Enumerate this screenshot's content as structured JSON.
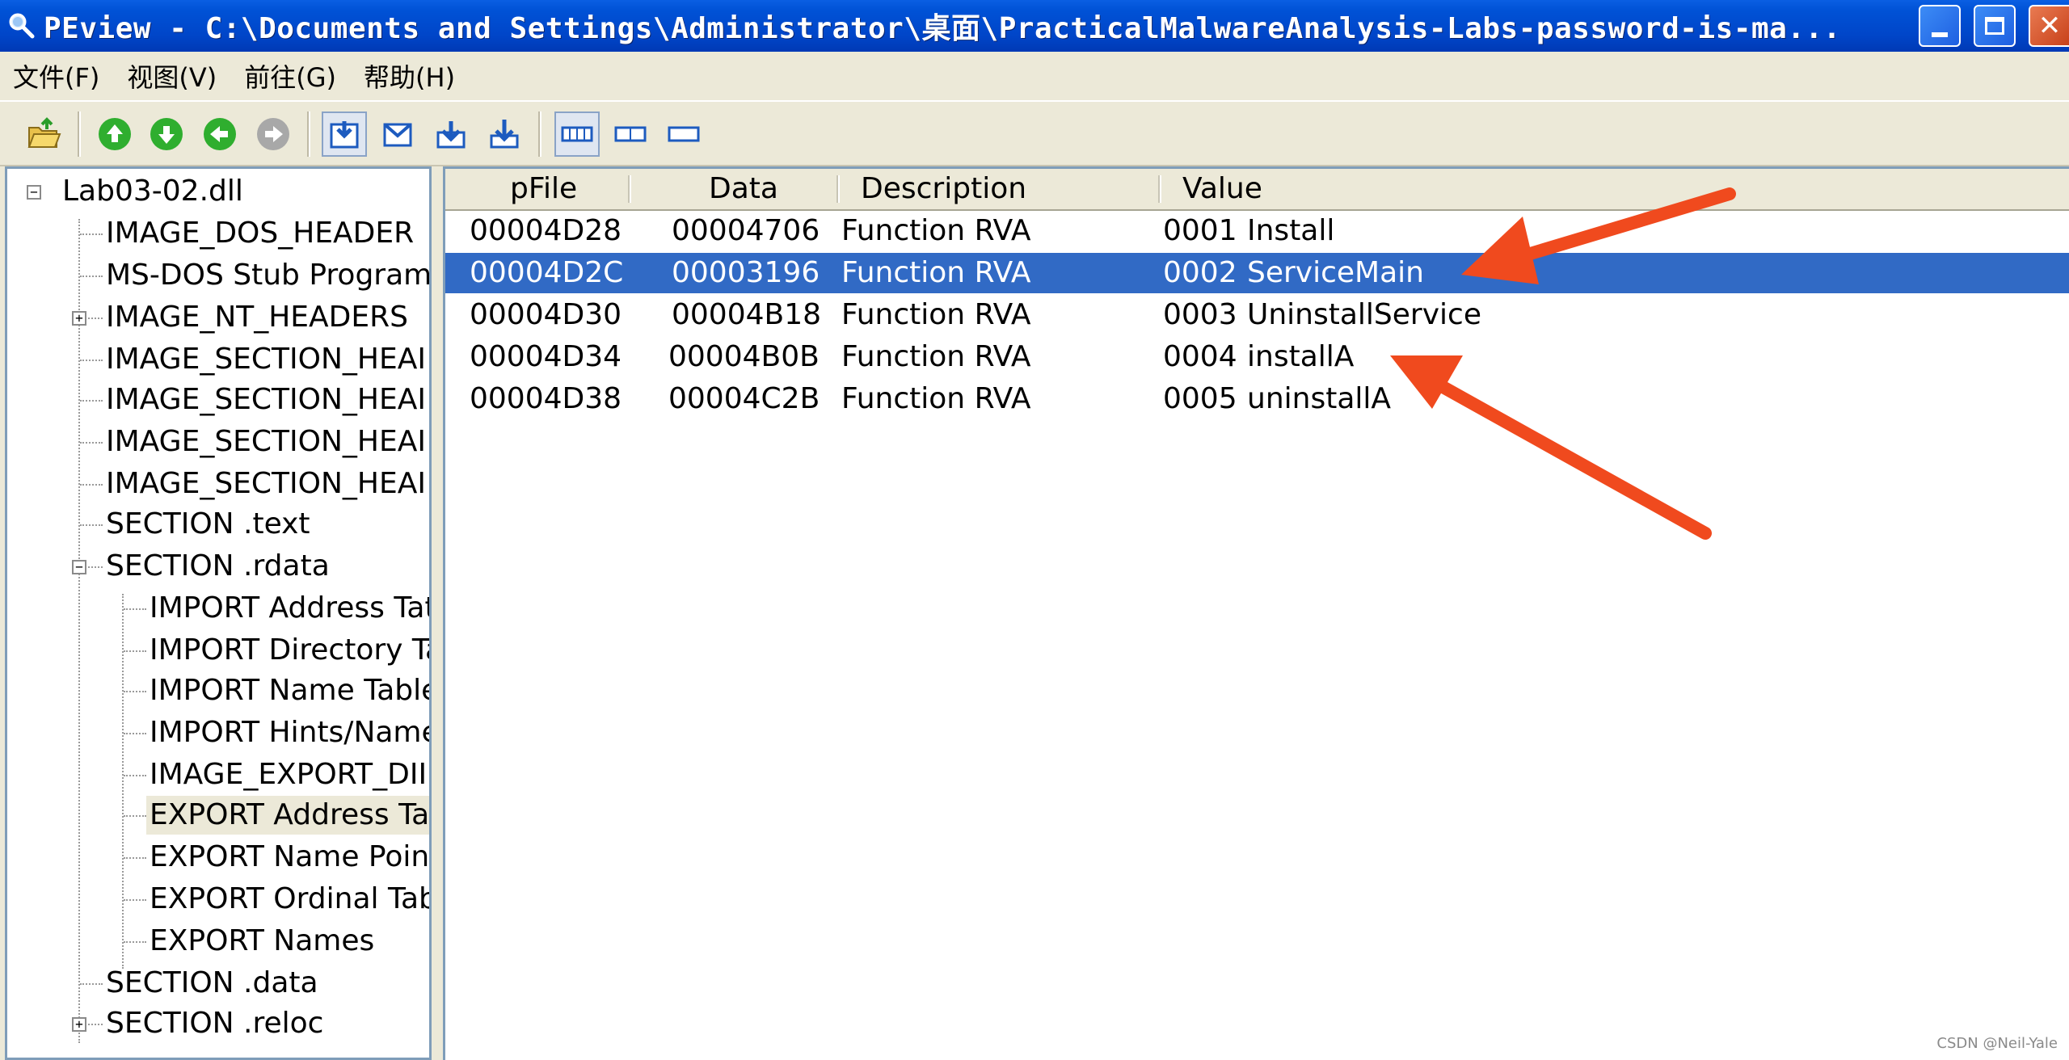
{
  "window": {
    "title": "PEview - C:\\Documents and Settings\\Administrator\\桌面\\PracticalMalwareAnalysis-Labs-password-is-ma..."
  },
  "menu": [
    "文件(F)",
    "视图(V)",
    "前往(G)",
    "帮助(H)"
  ],
  "toolbar": {
    "icons": [
      "open-folder-icon",
      "up-arrow-icon",
      "down-arrow-icon",
      "back-arrow-icon",
      "forward-arrow-icon",
      "view-down-icon",
      "view-mail-icon",
      "view-down2-icon",
      "view-down3-icon",
      "byte-view-icon",
      "word-view-icon",
      "dword-view-icon"
    ]
  },
  "tree": {
    "root": "Lab03-02.dll",
    "items": [
      {
        "label": "IMAGE_DOS_HEADER"
      },
      {
        "label": "MS-DOS Stub Program"
      },
      {
        "label": "IMAGE_NT_HEADERS"
      },
      {
        "label": "IMAGE_SECTION_HEAI"
      },
      {
        "label": "IMAGE_SECTION_HEAI"
      },
      {
        "label": "IMAGE_SECTION_HEAI"
      },
      {
        "label": "IMAGE_SECTION_HEAI"
      },
      {
        "label": "SECTION .text"
      },
      {
        "label": "SECTION .rdata"
      },
      {
        "label": "IMPORT Address Tat"
      },
      {
        "label": "IMPORT Directory Ta"
      },
      {
        "label": "IMPORT Name Table"
      },
      {
        "label": "IMPORT Hints/Name"
      },
      {
        "label": "IMAGE_EXPORT_DII"
      },
      {
        "label": "EXPORT Address Ta"
      },
      {
        "label": "EXPORT Name Point"
      },
      {
        "label": "EXPORT Ordinal Tab"
      },
      {
        "label": "EXPORT Names"
      },
      {
        "label": "SECTION .data"
      },
      {
        "label": "SECTION .reloc"
      }
    ]
  },
  "list": {
    "columns": [
      "pFile",
      "Data",
      "Description",
      "Value"
    ],
    "rows": [
      {
        "pfile": "00004D28",
        "data": "00004706",
        "desc": "Function RVA",
        "ord": "0001",
        "name": "Install"
      },
      {
        "pfile": "00004D2C",
        "data": "00003196",
        "desc": "Function RVA",
        "ord": "0002",
        "name": "ServiceMain"
      },
      {
        "pfile": "00004D30",
        "data": "00004B18",
        "desc": "Function RVA",
        "ord": "0003",
        "name": "UninstallService"
      },
      {
        "pfile": "00004D34",
        "data": "00004B0B",
        "desc": "Function RVA",
        "ord": "0004",
        "name": "installA"
      },
      {
        "pfile": "00004D38",
        "data": "00004C2B",
        "desc": "Function RVA",
        "ord": "0005",
        "name": "uninstallA"
      }
    ],
    "selected_row": 2
  },
  "colors": {
    "selection": "#316AC5",
    "arrow": "#F04A1E"
  },
  "watermark": "CSDN @Neil-Yale"
}
